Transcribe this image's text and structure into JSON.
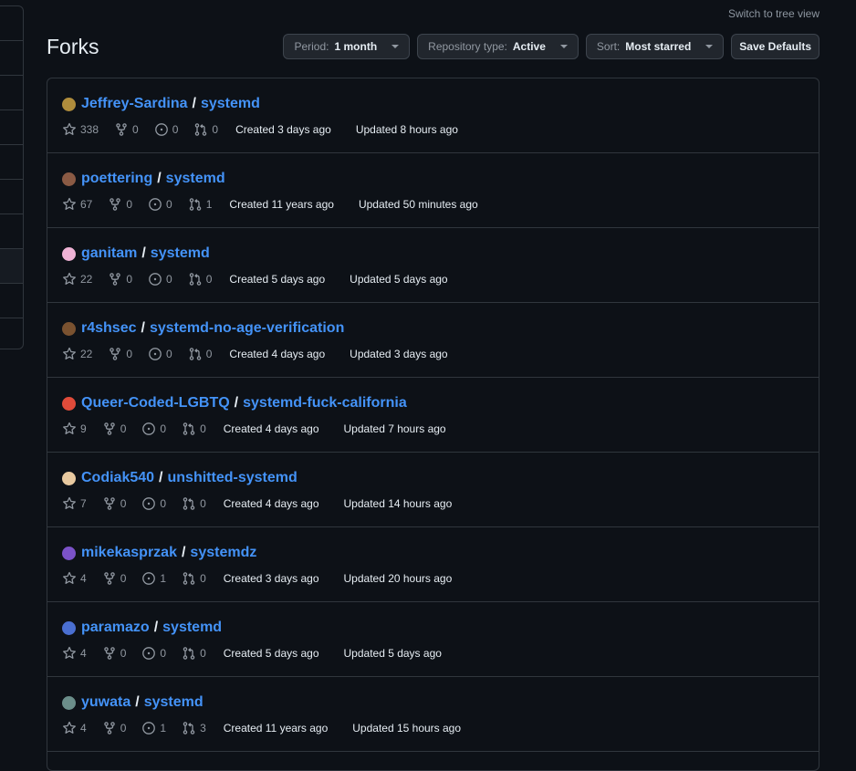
{
  "header": {
    "tree_link": "Switch to tree view",
    "title": "Forks",
    "period": {
      "label": "Period:",
      "value": "1 month"
    },
    "repo_type": {
      "label": "Repository type:",
      "value": "Active"
    },
    "sort": {
      "label": "Sort:",
      "value": "Most starred"
    },
    "save": "Save Defaults"
  },
  "forks": [
    {
      "owner": "Jeffrey-Sardina",
      "repo": "systemd",
      "stars": "338",
      "forks": "0",
      "issues": "0",
      "prs": "0",
      "created": "Created 3 days ago",
      "updated": "Updated 8 hours ago",
      "avatar_color": "#b08d3c"
    },
    {
      "owner": "poettering",
      "repo": "systemd",
      "stars": "67",
      "forks": "0",
      "issues": "0",
      "prs": "1",
      "created": "Created 11 years ago",
      "updated": "Updated 50 minutes ago",
      "avatar_color": "#8a5a44"
    },
    {
      "owner": "ganitam",
      "repo": "systemd",
      "stars": "22",
      "forks": "0",
      "issues": "0",
      "prs": "0",
      "created": "Created 5 days ago",
      "updated": "Updated 5 days ago",
      "avatar_color": "#f0b3d6"
    },
    {
      "owner": "r4shsec",
      "repo": "systemd-no-age-verification",
      "stars": "22",
      "forks": "0",
      "issues": "0",
      "prs": "0",
      "created": "Created 4 days ago",
      "updated": "Updated 3 days ago",
      "avatar_color": "#7a5230"
    },
    {
      "owner": "Queer-Coded-LGBTQ",
      "repo": "systemd-fuck-california",
      "stars": "9",
      "forks": "0",
      "issues": "0",
      "prs": "0",
      "created": "Created 4 days ago",
      "updated": "Updated 7 hours ago",
      "avatar_color": "#e04b3a"
    },
    {
      "owner": "Codiak540",
      "repo": "unshitted-systemd",
      "stars": "7",
      "forks": "0",
      "issues": "0",
      "prs": "0",
      "created": "Created 4 days ago",
      "updated": "Updated 14 hours ago",
      "avatar_color": "#e8c9a0"
    },
    {
      "owner": "mikekasprzak",
      "repo": "systemdz",
      "stars": "4",
      "forks": "0",
      "issues": "1",
      "prs": "0",
      "created": "Created 3 days ago",
      "updated": "Updated 20 hours ago",
      "avatar_color": "#7b52c8"
    },
    {
      "owner": "paramazo",
      "repo": "systemd",
      "stars": "4",
      "forks": "0",
      "issues": "0",
      "prs": "0",
      "created": "Created 5 days ago",
      "updated": "Updated 5 days ago",
      "avatar_color": "#4a6fd1"
    },
    {
      "owner": "yuwata",
      "repo": "systemd",
      "stars": "4",
      "forks": "0",
      "issues": "1",
      "prs": "3",
      "created": "Created 11 years ago",
      "updated": "Updated 15 hours ago",
      "avatar_color": "#6b8e8a"
    }
  ]
}
